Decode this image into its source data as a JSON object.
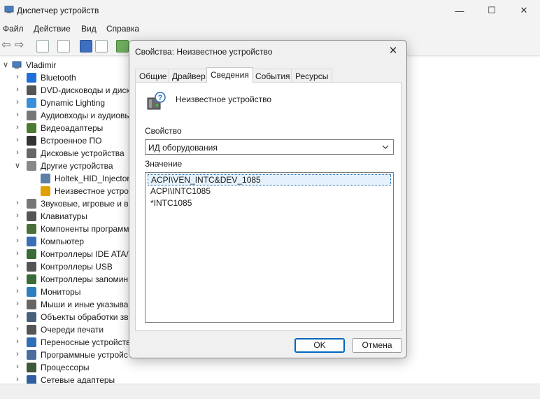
{
  "window": {
    "title": "Диспетчер устройств",
    "controls": {
      "minimize": "—",
      "maximize": "☐",
      "close": "✕"
    }
  },
  "menu": [
    "Файл",
    "Действие",
    "Вид",
    "Справка"
  ],
  "tree": {
    "root": "Vladimir",
    "items": [
      {
        "label": "Bluetooth",
        "icon": "bluetooth-icon",
        "expanded": false
      },
      {
        "label": "DVD-дисководы и диск",
        "icon": "dvd-drive-icon",
        "expanded": false
      },
      {
        "label": "Dynamic Lighting",
        "icon": "lighting-icon",
        "expanded": false
      },
      {
        "label": "Аудиовходы и аудиовы",
        "icon": "speaker-icon",
        "expanded": false
      },
      {
        "label": "Видеоадаптеры",
        "icon": "display-adapter-icon",
        "expanded": false
      },
      {
        "label": "Встроенное ПО",
        "icon": "firmware-icon",
        "expanded": false
      },
      {
        "label": "Дисковые устройства",
        "icon": "disk-drive-icon",
        "expanded": false
      },
      {
        "label": "Другие устройства",
        "icon": "other-devices-icon",
        "expanded": true
      },
      {
        "label": "Holtek_HID_Injector_",
        "icon": "unknown-device-icon",
        "child": true
      },
      {
        "label": "Неизвестное устрой",
        "icon": "unknown-device-warning-icon",
        "child": true
      },
      {
        "label": "Звуковые, игровые и в",
        "icon": "sound-icon",
        "expanded": false
      },
      {
        "label": "Клавиатуры",
        "icon": "keyboard-icon",
        "expanded": false
      },
      {
        "label": "Компоненты программ",
        "icon": "software-component-icon",
        "expanded": false
      },
      {
        "label": "Компьютер",
        "icon": "computer-icon",
        "expanded": false
      },
      {
        "label": "Контроллеры IDE ATA/",
        "icon": "ide-controller-icon",
        "expanded": false
      },
      {
        "label": "Контроллеры USB",
        "icon": "usb-icon",
        "expanded": false
      },
      {
        "label": "Контроллеры запомин",
        "icon": "storage-controller-icon",
        "expanded": false
      },
      {
        "label": "Мониторы",
        "icon": "monitor-icon",
        "expanded": false
      },
      {
        "label": "Мыши и иные указыва",
        "icon": "mouse-icon",
        "expanded": false
      },
      {
        "label": "Объекты обработки зв",
        "icon": "audio-processing-icon",
        "expanded": false
      },
      {
        "label": "Очереди печати",
        "icon": "printer-icon",
        "expanded": false
      },
      {
        "label": "Переносные устройств",
        "icon": "portable-device-icon",
        "expanded": false
      },
      {
        "label": "Программные устройс",
        "icon": "software-device-icon",
        "expanded": false
      },
      {
        "label": "Процессоры",
        "icon": "processor-icon",
        "expanded": false
      },
      {
        "label": "Сетевые адаптеры",
        "icon": "network-adapter-icon",
        "expanded": false
      }
    ]
  },
  "dialog": {
    "title": "Свойства: Неизвестное устройство",
    "close": "✕",
    "tabs": [
      "Общие",
      "Драйвер",
      "Сведения",
      "События",
      "Ресурсы"
    ],
    "active_tab": 2,
    "device_name": "Неизвестное устройство",
    "property_label": "Свойство",
    "property_value": "ИД оборудования",
    "value_label": "Значение",
    "values": [
      "ACPI\\VEN_INTC&DEV_1085",
      "ACPI\\INTC1085",
      "*INTC1085"
    ],
    "ok": "OK",
    "cancel": "Отмена"
  }
}
